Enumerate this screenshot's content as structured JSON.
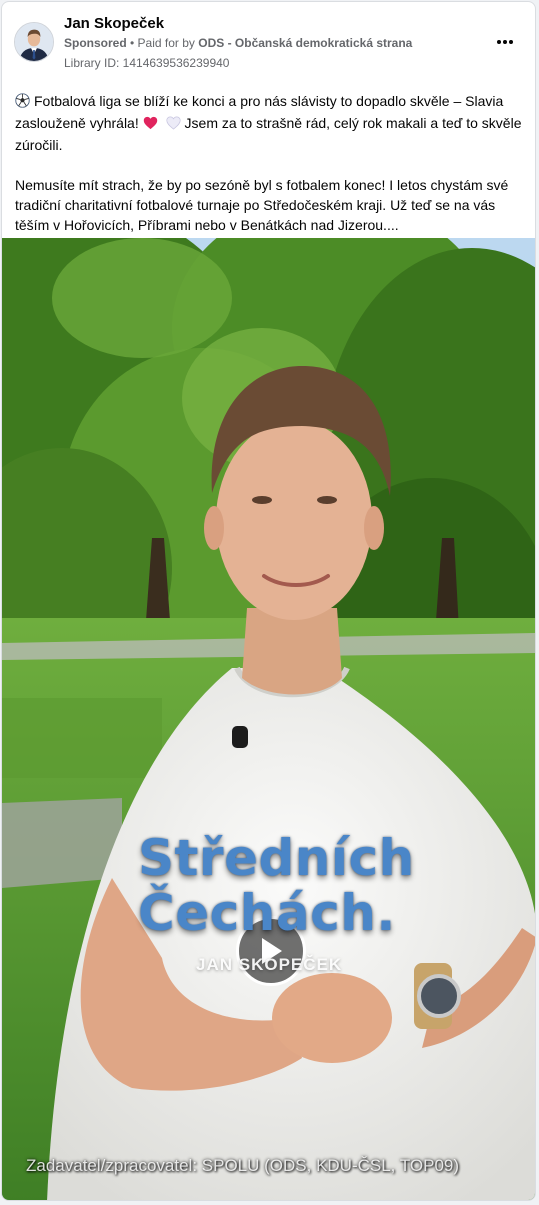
{
  "post": {
    "author": "Jan Skopeček",
    "sponsored": "Sponsored",
    "separator": " • ",
    "paid_for_prefix": "Paid for by ",
    "payer": "ODS - Občanská demokratická strana",
    "library_id": "Library ID: 1414639536239940",
    "more_icon": "more-horizontal-icon"
  },
  "text": {
    "p1_a": "Fotbalová liga se blíží ke konci a pro nás slávisty to dopadlo skvěle – Slavia zaslouženě vyhrála!",
    "p1_b": "Jsem za to strašně rád, celý rok makali a teď to skvěle zúročili.",
    "p2": "Nemusíte mít strach, že by po sezóně byl s fotbalem konec! I letos chystám své tradiční charitativní fotbalové turnaje po Středočeském kraji. Už teď se na vás těším v Hořovicích, Příbrami nebo v Benátkách nad Jizerou...."
  },
  "video": {
    "caption_line1": "Středních",
    "caption_line2": "Čechách.",
    "name_overlay": "JAN SKOPEČEK",
    "disclaimer": "Zadavatel/zpracovatel: SPOLU (ODS, KDU-ČSL, TOP09)",
    "play_icon": "play-icon"
  },
  "colors": {
    "caption_blue": "#4a86c8",
    "heart_red": "#e0245e",
    "heart_white": "#e8e8f5"
  }
}
